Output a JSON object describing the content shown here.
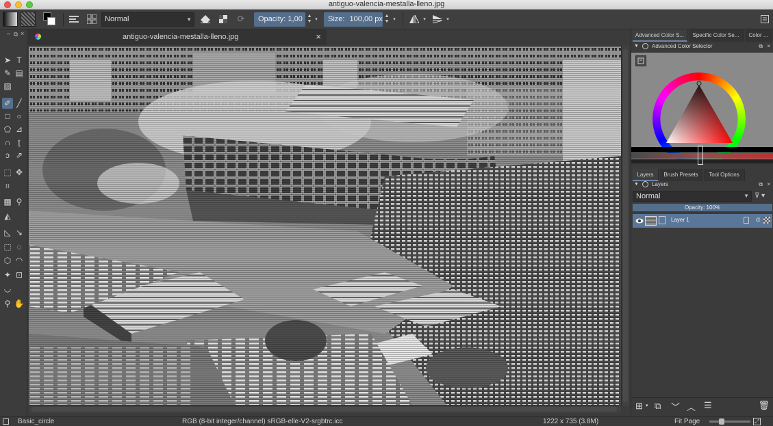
{
  "window": {
    "title": "antiguo-valencia-mestalla-lleno.jpg"
  },
  "toolbar": {
    "blend_mode": "Normal",
    "opacity_label": "Opacity: 1,00",
    "size_label": "Size:",
    "size_value": "100,00 px"
  },
  "document": {
    "tab_title": "antiguo-valencia-mestalla-lleno.jpg",
    "close_glyph": "×"
  },
  "dockers": {
    "top_tabs": [
      "Advanced Color S...",
      "Specific Color Se...",
      "Color ..."
    ],
    "color_selector_title": "Advanced Color Selector",
    "bottom_tabs": [
      "Layers",
      "Brush Presets",
      "Tool Options"
    ],
    "layers_title": "Layers",
    "layer_blend_mode": "Normal",
    "layer_opacity": "Opacity:  100%",
    "layers": [
      {
        "name": "Layer 1",
        "visible": true
      }
    ]
  },
  "status": {
    "brush": "Basic_circle",
    "color_space": "RGB (8-bit integer/channel)  sRGB-elle-V2-srgbtrc.icc",
    "dimensions": "1222 x 735 (3.8M)",
    "zoom_mode": "Fit Page"
  },
  "icons": {
    "tools": [
      "select-shapes-icon",
      "text-icon",
      "edit-shapes-icon",
      "calligraphy-icon",
      "gradient-editor-icon",
      "pattern-icon",
      "freehand-brush-icon",
      "line-icon",
      "rectangle-icon",
      "ellipse-icon",
      "polygon-icon",
      "polyline-icon",
      "bezier-icon",
      "freehand-path-icon",
      "dynamic-brush-icon",
      "multibrush-icon",
      "transform-icon",
      "move-icon",
      "crop-icon",
      "gradient-icon",
      "color-picker-icon",
      "fill-icon",
      "assistant-icon",
      "measure-icon",
      "rect-select-icon",
      "ellipse-select-icon",
      "polygon-select-icon",
      "freehand-select-icon",
      "contiguous-select-icon",
      "similar-select-icon",
      "bezier-select-icon",
      "zoom-icon",
      "pan-icon"
    ]
  },
  "colors": {
    "accent": "#556e8c",
    "layer_selected": "#5a7799",
    "panel_bg": "#3b3b3b"
  }
}
